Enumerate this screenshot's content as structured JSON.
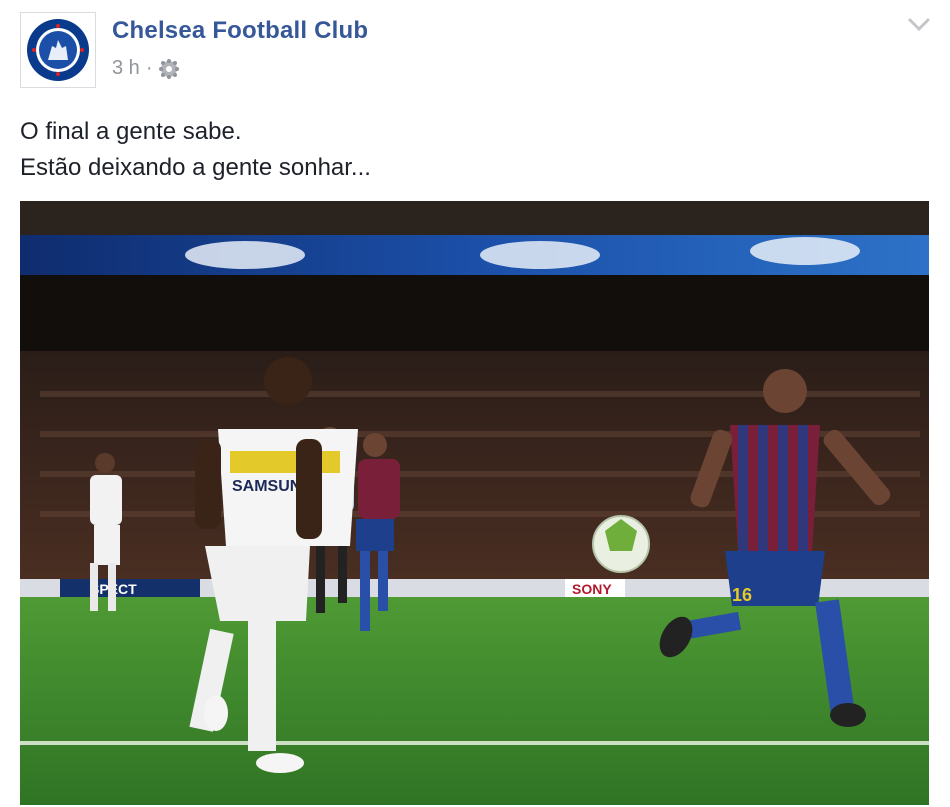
{
  "post": {
    "page_name": "Chelsea Football Club",
    "timestamp": "3 h",
    "separator": "·",
    "privacy_icon": "public-globe-icon",
    "message_lines": [
      "O final a gente sabe.",
      "Estão deixando a gente sonhar..."
    ]
  },
  "photo": {
    "jersey_sponsor": "SAMSUNG",
    "boards_text": "SPECT",
    "sponsor_board": "SONY",
    "player_number": "16"
  },
  "colors": {
    "page_name": "#365899",
    "meta": "#90949c",
    "text": "#1d2129",
    "pitch": "#3f8a2e"
  }
}
